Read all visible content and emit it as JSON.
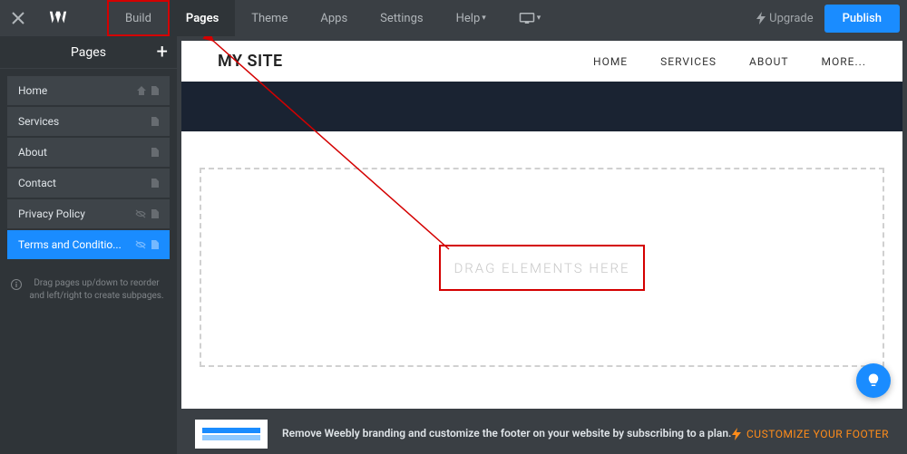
{
  "topbar": {
    "menu": [
      {
        "label": "Build",
        "active": false,
        "highlighted": true
      },
      {
        "label": "Pages",
        "active": true,
        "highlighted": false
      },
      {
        "label": "Theme",
        "active": false,
        "highlighted": false
      },
      {
        "label": "Apps",
        "active": false,
        "highlighted": false
      },
      {
        "label": "Settings",
        "active": false,
        "highlighted": false
      },
      {
        "label": "Help",
        "active": false,
        "highlighted": false,
        "dropdown": true
      }
    ],
    "upgrade_label": "Upgrade",
    "publish_label": "Publish"
  },
  "sidebar": {
    "title": "Pages",
    "pages": [
      {
        "label": "Home",
        "selected": false,
        "home_icon": true,
        "hidden": false
      },
      {
        "label": "Services",
        "selected": false,
        "home_icon": false,
        "hidden": false
      },
      {
        "label": "About",
        "selected": false,
        "home_icon": false,
        "hidden": false
      },
      {
        "label": "Contact",
        "selected": false,
        "home_icon": false,
        "hidden": false
      },
      {
        "label": "Privacy Policy",
        "selected": false,
        "home_icon": false,
        "hidden": true
      },
      {
        "label": "Terms and Conditio...",
        "selected": true,
        "home_icon": false,
        "hidden": true
      }
    ],
    "hint": "Drag pages up/down to reorder and left/right to create subpages."
  },
  "site": {
    "title": "MY SITE",
    "nav": [
      {
        "label": "HOME"
      },
      {
        "label": "SERVICES"
      },
      {
        "label": "ABOUT"
      },
      {
        "label": "MORE..."
      }
    ],
    "drop_zone_text": "DRAG ELEMENTS HERE"
  },
  "footer_promo": {
    "text": "Remove Weebly branding and customize the footer on your website by subscribing to a plan.",
    "cta": "CUSTOMIZE YOUR FOOTER"
  }
}
